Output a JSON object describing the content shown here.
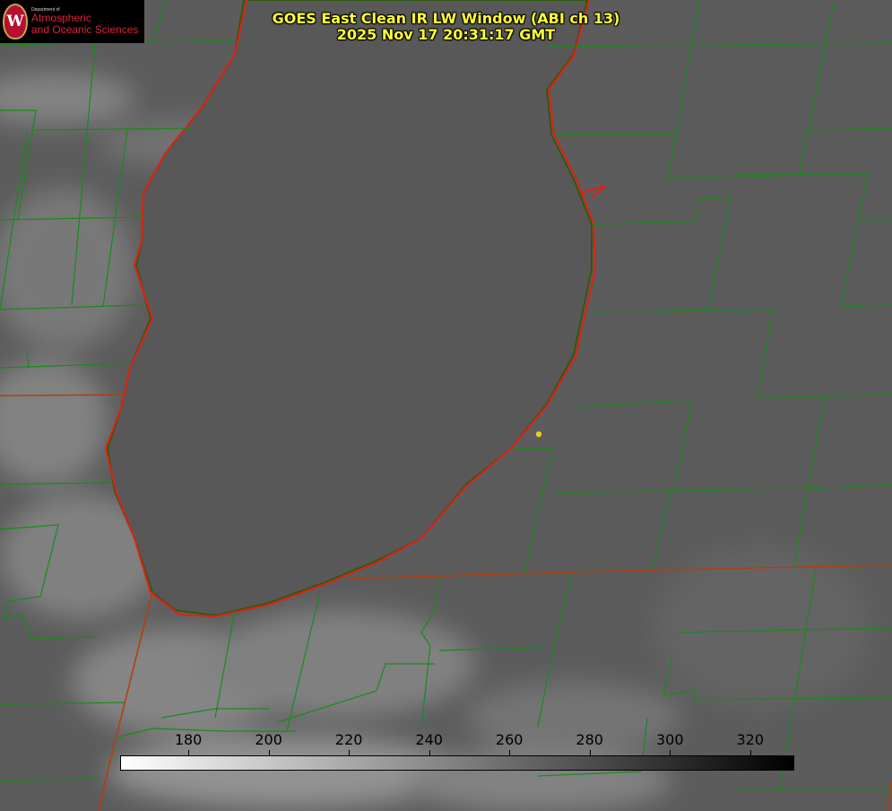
{
  "logo": {
    "department": "Department of",
    "line1": "Atmospheric",
    "line2": "and Oceanic Sciences",
    "seal_letter": "W"
  },
  "title": {
    "line1": "GOES East Clean IR LW Window (ABI ch 13)",
    "line2": "2025 Nov 17 20:31:17 GMT"
  },
  "colorbar": {
    "ticks": [
      "180",
      "200",
      "220",
      "240",
      "260",
      "280",
      "300",
      "320"
    ],
    "range": [
      163,
      331
    ],
    "gradient": "white-to-black"
  },
  "colors": {
    "title": "#ffff33",
    "county_lines": "#1a8a1a",
    "shoreline": "#e02010",
    "state_line": "#b04010",
    "station_marker": "#e8d020",
    "lake": "#5a5a5a"
  }
}
